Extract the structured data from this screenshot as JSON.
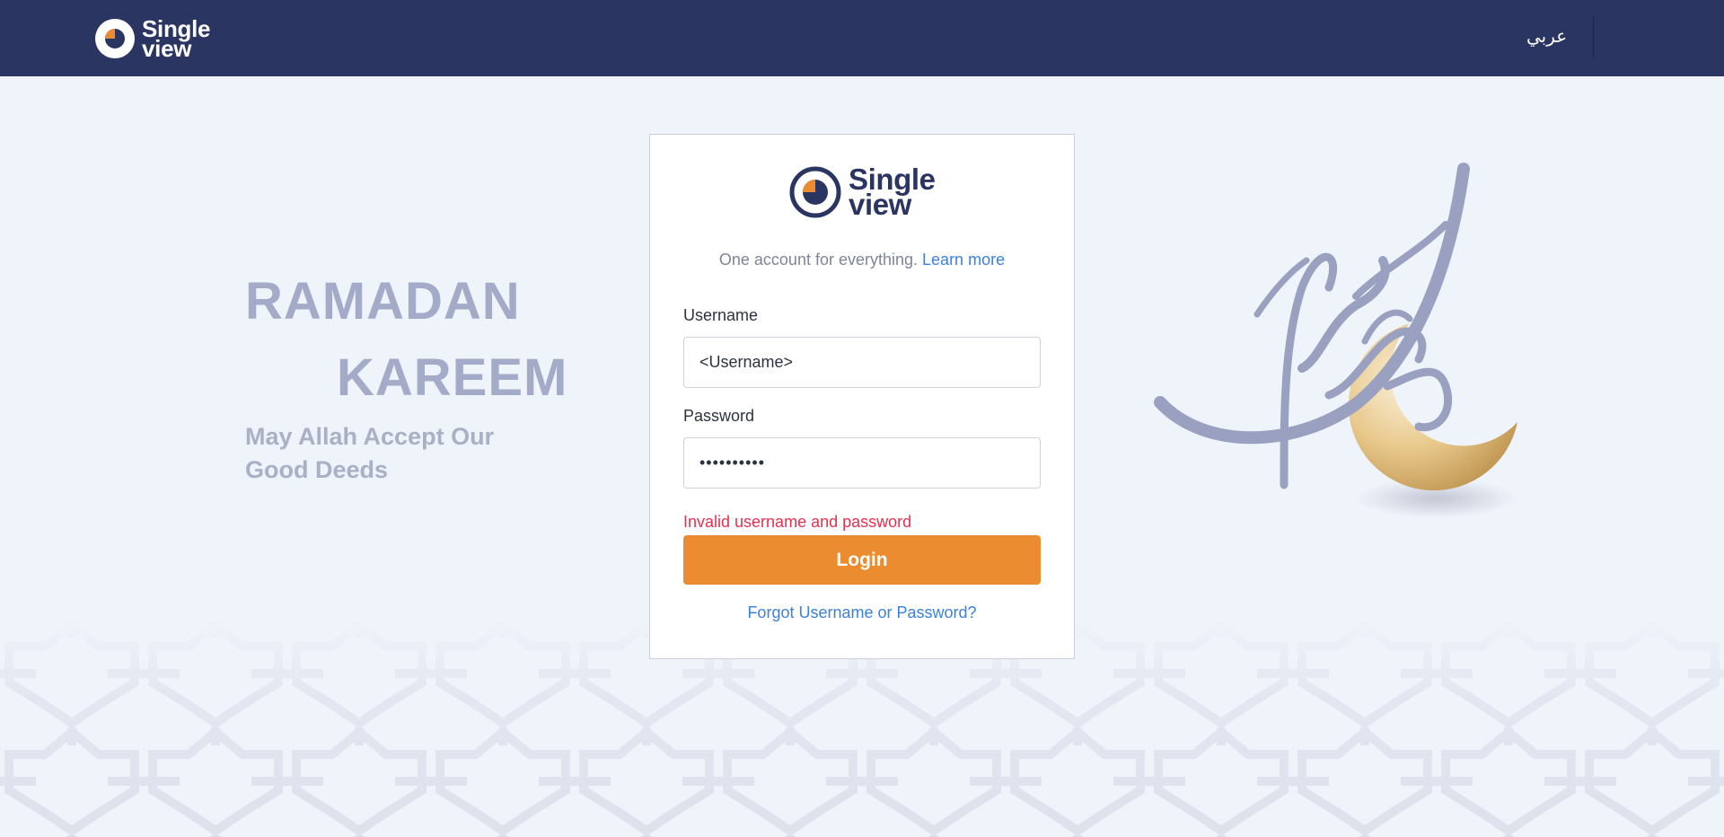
{
  "header": {
    "logo_line1": "Single",
    "logo_line2": "view",
    "language_link": "عربي"
  },
  "greeting": {
    "line1": "RAMADAN",
    "line2": "KAREEM",
    "subtitle": "May Allah Accept Our Good Deeds"
  },
  "login": {
    "logo_line1": "Single",
    "logo_line2": "view",
    "tagline": "One account for everything.",
    "learn_more": "Learn more",
    "username_label": "Username",
    "username_value": "<Username>",
    "password_label": "Password",
    "password_value": "••••••••••",
    "error_message": "Invalid username and password",
    "login_button": "Login",
    "forgot_link": "Forgot Username or Password?"
  },
  "colors": {
    "header_bg": "#2b3562",
    "page_bg": "#eff3fa",
    "accent_orange": "#ec8c30",
    "link_blue": "#3a80e0",
    "error_red": "#e8304e",
    "greeting_gray": "#a3abc9"
  },
  "icons": {
    "logo": "single-view-logo-icon",
    "art": "ramadan-calligraphy-crescent-art"
  }
}
